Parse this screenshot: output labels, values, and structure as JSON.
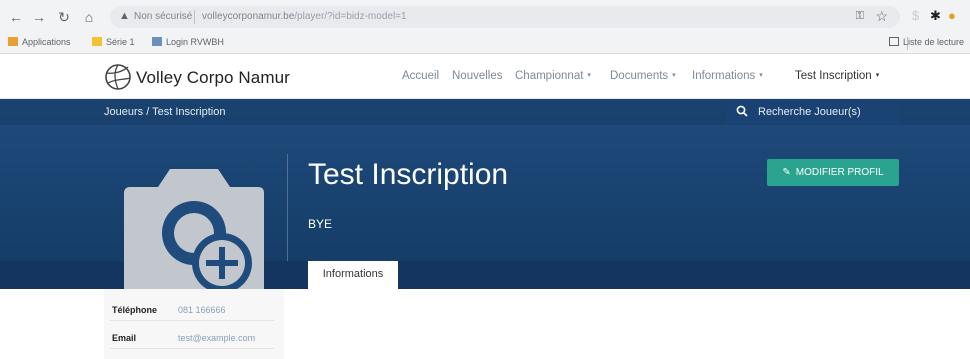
{
  "browser": {
    "not_secure": "Non sécurisé",
    "url_host": "volleycorponamur.be",
    "url_path": "/player/?id=bidz-model=1",
    "bookmarks": [
      "Applications",
      "Série 1",
      "Login RVWBH"
    ],
    "bookmarks_right": "Liste de lecture"
  },
  "site": {
    "logo_text": "Volley Corpo Namur",
    "menu": [
      {
        "label": "Accueil"
      },
      {
        "label": "Nouvelles"
      },
      {
        "label": "Championnat",
        "caret": "▾"
      },
      {
        "label": "Documents",
        "caret": "▾"
      },
      {
        "label": "Informations",
        "caret": "▾"
      },
      {
        "label": "Test Inscription",
        "caret": "▾"
      }
    ]
  },
  "breadcrumb": {
    "text": "Joueurs  /  Test Inscription"
  },
  "search": {
    "label": "Recherche Joueur(s)"
  },
  "player": {
    "name": "Test Inscription",
    "team": "BYE",
    "edit_label": "MODIFIER PROFIL"
  },
  "tabs": [
    {
      "label": "Informations",
      "active": true
    }
  ],
  "info": [
    {
      "key": "Téléphone",
      "value": "081 166666"
    },
    {
      "key": "Email",
      "value": "test@example.com"
    }
  ],
  "colors": {
    "hero": "#1f4b7d",
    "accent": "#2aa38f"
  },
  "icons": {
    "search": "search-icon",
    "edit": "pencil-icon",
    "avatar": "camera-plus-icon",
    "logo": "volleyball-icon"
  }
}
